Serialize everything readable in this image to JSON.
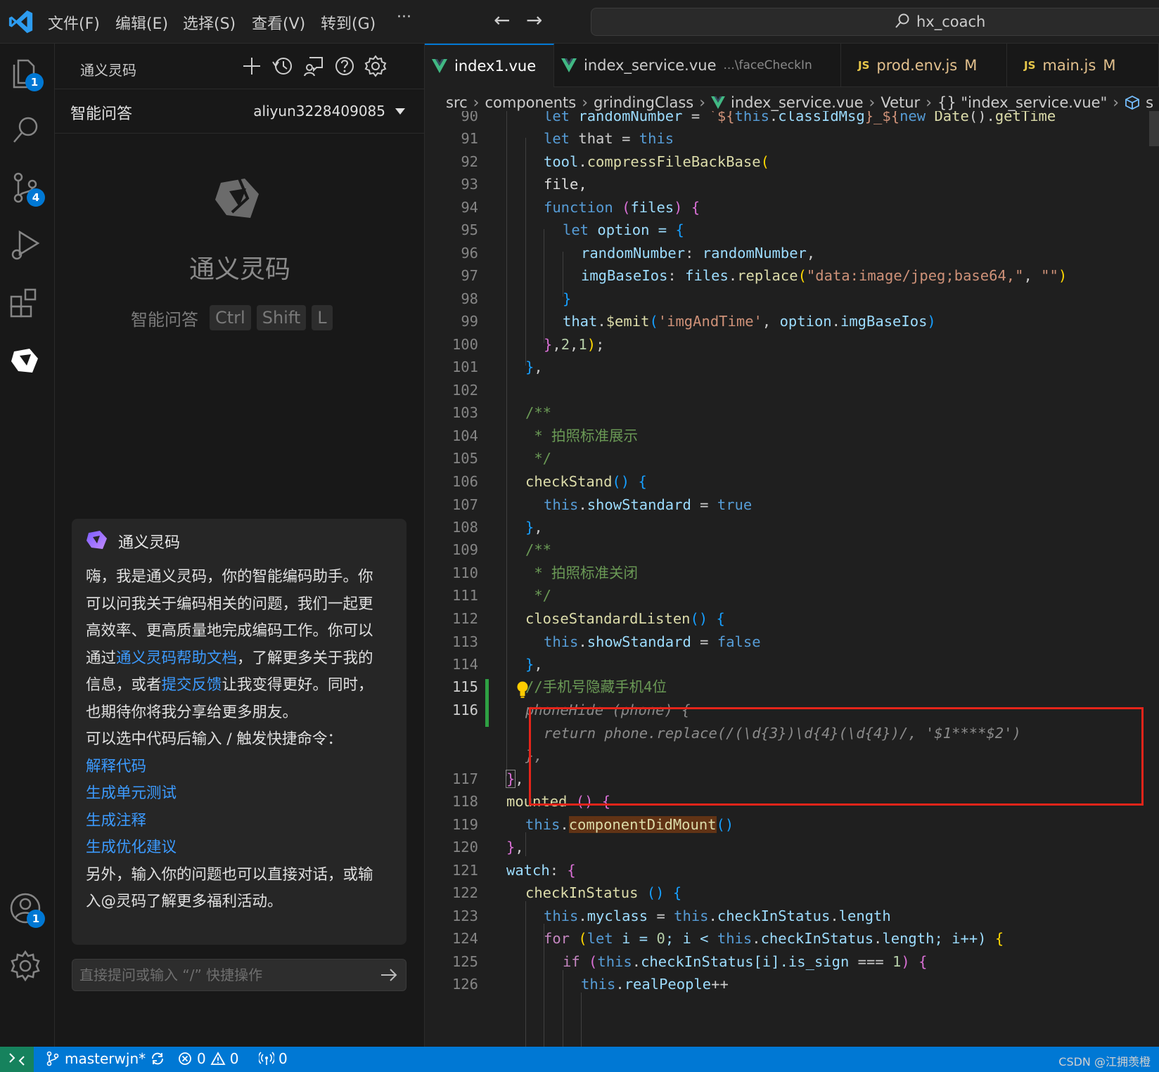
{
  "titlebar": {
    "menus": [
      "文件(F)",
      "编辑(E)",
      "选择(S)",
      "查看(V)",
      "转到(G)"
    ],
    "more": "···",
    "back": "←",
    "forward": "→",
    "command_center": "hx_coach"
  },
  "activity": {
    "explorer_badge": "1",
    "scm_badge": "4",
    "account_badge": "1"
  },
  "sidebar": {
    "title": "通义灵码",
    "mode": "智能问答",
    "account": "aliyun3228409085",
    "welcome_name": "通义灵码",
    "shortcut_hint": "智能问答",
    "shortcut_keys": [
      "Ctrl",
      "Shift",
      "L"
    ]
  },
  "assistant": {
    "name": "通义灵码",
    "p1": "嗨，我是通义灵码，你的智能编码助手。你可以问我关于编码相关的问题，我们一起更高效率、更高质量地完成编码工作。你可以通过",
    "help_link": "通义灵码帮助文档",
    "p2": "，了解更多关于我的信息，或者",
    "feedback_link": "提交反馈",
    "p3": "让我变得更好。同时，也期待你将我分享给更多朋友。",
    "p4": "可以选中代码后输入 / 触发快捷命令：",
    "commands": [
      "解释代码",
      "生成单元测试",
      "生成注释",
      "生成优化建议"
    ],
    "p5": "另外，输入你的问题也可以直接对话，或输入@灵码了解更多福利活动。"
  },
  "chat_input": {
    "placeholder": "直接提问或输入 “/” 快捷操作"
  },
  "tabs": [
    {
      "label": "index1.vue",
      "desc": "",
      "mod": ""
    },
    {
      "label": "index_service.vue",
      "desc": "...\\faceCheckIn",
      "mod": ""
    },
    {
      "label": "prod.env.js",
      "desc": "",
      "mod": "M"
    },
    {
      "label": "main.js",
      "desc": "",
      "mod": "M"
    }
  ],
  "breadcrumb": [
    "src",
    "components",
    "grindingClass",
    "index_service.vue",
    "Vetur",
    "{} \"index_service.vue\"",
    "s"
  ],
  "line_numbers": [
    "90",
    "91",
    "92",
    "93",
    "94",
    "95",
    "96",
    "97",
    "98",
    "99",
    "100",
    "101",
    "102",
    "103",
    "104",
    "105",
    "106",
    "107",
    "108",
    "109",
    "110",
    "111",
    "112",
    "113",
    "114",
    "115",
    "116",
    "117",
    "118",
    "119",
    "120",
    "121",
    "122",
    "123",
    "124",
    "125",
    "126"
  ],
  "code": {
    "l90": "let randomNumber = `${this.classIdMsg}_${new Date().getTime",
    "l91": [
      "let",
      " that = ",
      "this"
    ],
    "l92": [
      "tool",
      ".",
      "compressFileBackBase",
      "("
    ],
    "l93": "file,",
    "l94": [
      "function",
      " (",
      "files",
      ") ",
      "{"
    ],
    "l95": [
      "let",
      " option = ",
      "{"
    ],
    "l96": [
      "randomNumber",
      ": ",
      "randomNumber",
      ","
    ],
    "l97": [
      "imgBaseIos",
      ": ",
      "files",
      ".",
      "replace",
      "(",
      "\"data:image/jpeg;base64,\"",
      ", ",
      "\"\"",
      ")"
    ],
    "l98": "}",
    "l99": [
      "that",
      ".",
      "$emit",
      "(",
      "'imgAndTime'",
      ", ",
      "option",
      ".",
      "imgBaseIos",
      ")"
    ],
    "l100": [
      "}",
      ",",
      "2",
      ",",
      "1",
      ")",
      ";"
    ],
    "l101": [
      "}",
      ","
    ],
    "l103": "/**",
    "l104": " * 拍照标准展示",
    "l105": " */",
    "l106": [
      "checkStand",
      "() ",
      "{"
    ],
    "l107": [
      "this",
      ".",
      "showStandard",
      " = ",
      "true"
    ],
    "l108": [
      "}",
      ","
    ],
    "l109": "/**",
    "l110": " * 拍照标准关闭",
    "l111": " */",
    "l112": [
      "closeStandardListen",
      "() ",
      "{"
    ],
    "l113": [
      "this",
      ".",
      "showStandard",
      " = ",
      "false"
    ],
    "l114": [
      "}",
      ","
    ],
    "l115": "//手机号隐藏手机4位",
    "l116": "phoneHide (phone) {",
    "ghost1": "return phone.replace(/(\\d{3})\\d{4}(\\d{4})/, '$1****$2')",
    "ghost2": "},",
    "l117": [
      "}",
      ","
    ],
    "l118": [
      "mounted",
      " ",
      "()",
      " ",
      "{"
    ],
    "l119": [
      "this",
      ".",
      "componentDidMount",
      "()"
    ],
    "l120": [
      "}",
      ","
    ],
    "l121": [
      "watch",
      ": ",
      "{"
    ],
    "l122": [
      "checkInStatus",
      " ",
      "()",
      " ",
      "{"
    ],
    "l123": [
      "this",
      ".",
      "myclass",
      " = ",
      "this",
      ".",
      "checkInStatus",
      ".",
      "length"
    ],
    "l124": [
      "for",
      " (",
      "let",
      " i = ",
      "0",
      "; i < ",
      "this",
      ".",
      "checkInStatus",
      ".",
      "length",
      "; i++) ",
      "{"
    ],
    "l125": [
      "if",
      " (",
      "this",
      ".",
      "checkInStatus",
      "[i].",
      "is_sign",
      " === ",
      "1",
      ") ",
      "{"
    ],
    "l126": [
      "this",
      ".",
      "realPeople",
      "++"
    ]
  },
  "statusbar": {
    "branch": "masterwjn*",
    "errors": "0",
    "warnings": "0",
    "ports": "0",
    "watermark": "CSDN @江拥羡橙"
  },
  "colors": {
    "accent": "#0078d4",
    "highlight_box": "#e5241a",
    "link": "#3c9bff",
    "modified_gutter": "#2ea043"
  }
}
